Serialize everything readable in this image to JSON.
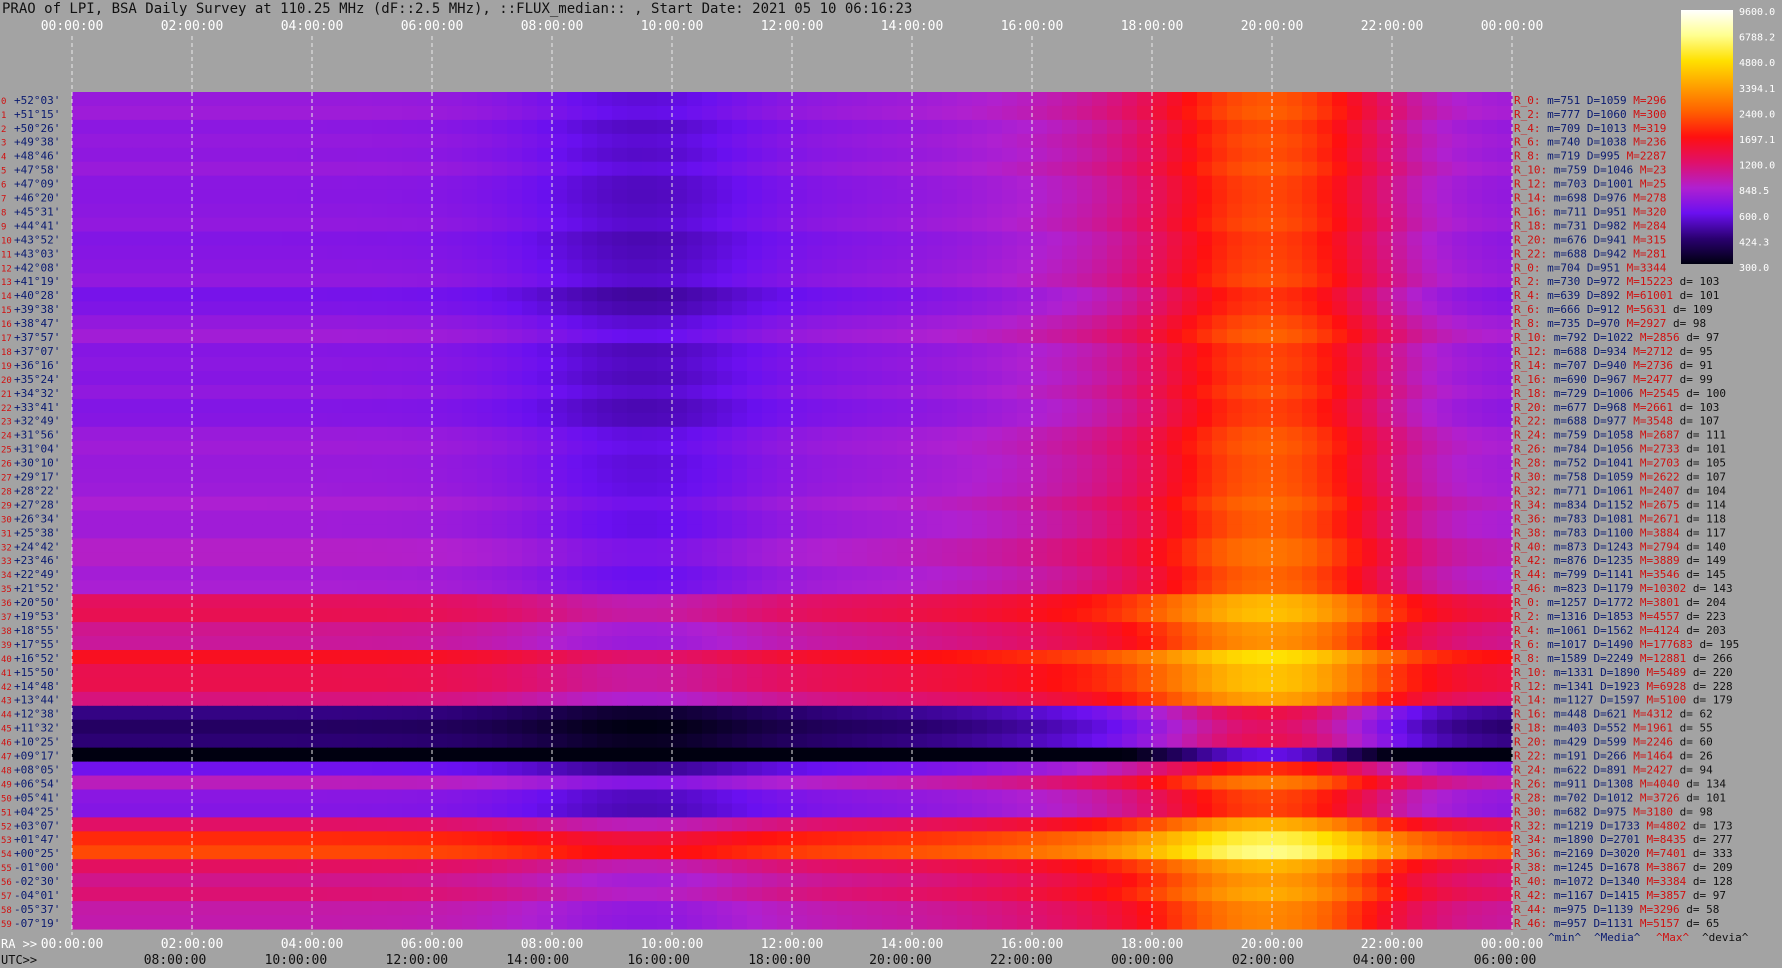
{
  "title": "PRAO of LPI, BSA Daily Survey at 110.25 MHz (dF::2.5 MHz), ::FLUX_median:: , Start Date: 2021 05 10 06:16:23",
  "bottom_labels": {
    "ra": "RA >>",
    "utc": "UTC>>"
  },
  "stats_footer": {
    "min": "^min^",
    "media": "^Media^",
    "max": "^Max^",
    "devia": "^devia^"
  },
  "colorbar": {
    "labels": [
      "9600.0",
      "6788.2",
      "4800.0",
      "3394.1",
      "2400.0",
      "1697.1",
      "1200.0",
      "848.5",
      "600.0",
      "424.3",
      "300.0"
    ],
    "colors": [
      "#ffffff",
      "#ffff90",
      "#ffe000",
      "#ffa000",
      "#ff6000",
      "#ff1010",
      "#e0106a",
      "#b020d0",
      "#6a10f0",
      "#2a0070",
      "#000010"
    ]
  },
  "chart_data": {
    "type": "heatmap",
    "title": "PRAO of LPI, BSA Daily Survey at 110.25 MHz (dF::2.5 MHz), ::FLUX_median:: , Start Date: 2021 05 10 06:16:23",
    "x_top_ticks": [
      "00:00:00",
      "02:00:00",
      "04:00:00",
      "06:00:00",
      "08:00:00",
      "10:00:00",
      "12:00:00",
      "14:00:00",
      "16:00:00",
      "18:00:00",
      "20:00:00",
      "22:00:00",
      "00:00:00"
    ],
    "x_ra_ticks": [
      "00:00:00",
      "02:00:00",
      "04:00:00",
      "06:00:00",
      "08:00:00",
      "10:00:00",
      "12:00:00",
      "14:00:00",
      "16:00:00",
      "18:00:00",
      "20:00:00",
      "22:00:00",
      "00:00:00"
    ],
    "x_utc_ticks": [
      "08:00:00",
      "10:00:00",
      "12:00:00",
      "14:00:00",
      "16:00:00",
      "18:00:00",
      "20:00:00",
      "22:00:00",
      "00:00:00",
      "02:00:00",
      "04:00:00",
      "06:00:00"
    ],
    "rows": [
      {
        "idx": "0",
        "dec": "+52°03'"
      },
      {
        "idx": "1",
        "dec": "+51°15'"
      },
      {
        "idx": "2",
        "dec": "+50°26'"
      },
      {
        "idx": "3",
        "dec": "+49°38'"
      },
      {
        "idx": "4",
        "dec": "+48°46'"
      },
      {
        "idx": "5",
        "dec": "+47°58'"
      },
      {
        "idx": "6",
        "dec": "+47°09'"
      },
      {
        "idx": "7",
        "dec": "+46°20'"
      },
      {
        "idx": "8",
        "dec": "+45°31'"
      },
      {
        "idx": "9",
        "dec": "+44°41'"
      },
      {
        "idx": "10",
        "dec": "+43°52'"
      },
      {
        "idx": "11",
        "dec": "+43°03'"
      },
      {
        "idx": "12",
        "dec": "+42°08'"
      },
      {
        "idx": "13",
        "dec": "+41°19'"
      },
      {
        "idx": "14",
        "dec": "+40°28'"
      },
      {
        "idx": "15",
        "dec": "+39°38'"
      },
      {
        "idx": "16",
        "dec": "+38°47'"
      },
      {
        "idx": "17",
        "dec": "+37°57'"
      },
      {
        "idx": "18",
        "dec": "+37°07'"
      },
      {
        "idx": "19",
        "dec": "+36°16'"
      },
      {
        "idx": "20",
        "dec": "+35°24'"
      },
      {
        "idx": "21",
        "dec": "+34°32'"
      },
      {
        "idx": "22",
        "dec": "+33°41'"
      },
      {
        "idx": "23",
        "dec": "+32°49'"
      },
      {
        "idx": "24",
        "dec": "+31°56'"
      },
      {
        "idx": "25",
        "dec": "+31°04'"
      },
      {
        "idx": "26",
        "dec": "+30°10'"
      },
      {
        "idx": "27",
        "dec": "+29°17'"
      },
      {
        "idx": "28",
        "dec": "+28°22'"
      },
      {
        "idx": "29",
        "dec": "+27°28'"
      },
      {
        "idx": "30",
        "dec": "+26°34'"
      },
      {
        "idx": "31",
        "dec": "+25°38'"
      },
      {
        "idx": "32",
        "dec": "+24°42'"
      },
      {
        "idx": "33",
        "dec": "+23°46'"
      },
      {
        "idx": "34",
        "dec": "+22°49'"
      },
      {
        "idx": "35",
        "dec": "+21°52'"
      },
      {
        "idx": "36",
        "dec": "+20°50'"
      },
      {
        "idx": "37",
        "dec": "+19°53'"
      },
      {
        "idx": "38",
        "dec": "+18°55'"
      },
      {
        "idx": "39",
        "dec": "+17°55'"
      },
      {
        "idx": "40",
        "dec": "+16°52'"
      },
      {
        "idx": "41",
        "dec": "+15°50'"
      },
      {
        "idx": "42",
        "dec": "+14°48'"
      },
      {
        "idx": "43",
        "dec": "+13°44'"
      },
      {
        "idx": "44",
        "dec": "+12°38'"
      },
      {
        "idx": "45",
        "dec": "+11°32'"
      },
      {
        "idx": "46",
        "dec": "+10°25'"
      },
      {
        "idx": "47",
        "dec": "+09°17'"
      },
      {
        "idx": "48",
        "dec": "+08°05'"
      },
      {
        "idx": "49",
        "dec": "+06°54'"
      },
      {
        "idx": "50",
        "dec": "+05°41'"
      },
      {
        "idx": "51",
        "dec": "+04°25'"
      },
      {
        "idx": "52",
        "dec": "+03°07'"
      },
      {
        "idx": "53",
        "dec": "+01°47'"
      },
      {
        "idx": "54",
        "dec": "+00°25'"
      },
      {
        "idx": "55",
        "dec": "-01°00'"
      },
      {
        "idx": "56",
        "dec": "-02°30'"
      },
      {
        "idx": "57",
        "dec": "-04°01'"
      },
      {
        "idx": "58",
        "dec": "-05°37'"
      },
      {
        "idx": "59",
        "dec": "-07°19'"
      }
    ],
    "stats": [
      {
        "r": "R_0:",
        "m": "m=751",
        "d": "D=1059",
        "M": "M=296",
        "dd": ""
      },
      {
        "r": "R_2:",
        "m": "m=777",
        "d": "D=1060",
        "M": "M=300",
        "dd": ""
      },
      {
        "r": "R_4:",
        "m": "m=709",
        "d": "D=1013",
        "M": "M=319",
        "dd": ""
      },
      {
        "r": "R_6:",
        "m": "m=740",
        "d": "D=1038",
        "M": "M=236",
        "dd": ""
      },
      {
        "r": "R_8:",
        "m": "m=719",
        "d": "D=995",
        "M": "M=2287",
        "dd": ""
      },
      {
        "r": "R_10:",
        "m": "m=759",
        "d": "D=1046",
        "M": "M=23",
        "dd": ""
      },
      {
        "r": "R_12:",
        "m": "m=703",
        "d": "D=1001",
        "M": "M=25",
        "dd": ""
      },
      {
        "r": "R_14:",
        "m": "m=698",
        "d": "D=976",
        "M": "M=278",
        "dd": ""
      },
      {
        "r": "R_16:",
        "m": "m=711",
        "d": "D=951",
        "M": "M=320",
        "dd": ""
      },
      {
        "r": "R_18:",
        "m": "m=731",
        "d": "D=982",
        "M": "M=284",
        "dd": ""
      },
      {
        "r": "R_20:",
        "m": "m=676",
        "d": "D=941",
        "M": "M=315",
        "dd": ""
      },
      {
        "r": "R_22:",
        "m": "m=688",
        "d": "D=942",
        "M": "M=281",
        "dd": ""
      },
      {
        "r": "R_0:",
        "m": "m=704",
        "d": "D=951",
        "M": "M=3344",
        "dd": ""
      },
      {
        "r": "R_2:",
        "m": "m=730",
        "d": "D=972",
        "M": "M=15223",
        "dd": "d= 103"
      },
      {
        "r": "R_4:",
        "m": "m=639",
        "d": "D=892",
        "M": "M=61001",
        "dd": "d= 101"
      },
      {
        "r": "R_6:",
        "m": "m=666",
        "d": "D=912",
        "M": "M=5631",
        "dd": "d= 109"
      },
      {
        "r": "R_8:",
        "m": "m=735",
        "d": "D=970",
        "M": "M=2927",
        "dd": "d= 98"
      },
      {
        "r": "R_10:",
        "m": "m=792",
        "d": "D=1022",
        "M": "M=2856",
        "dd": "d= 97"
      },
      {
        "r": "R_12:",
        "m": "m=688",
        "d": "D=934",
        "M": "M=2712",
        "dd": "d= 95"
      },
      {
        "r": "R_14:",
        "m": "m=707",
        "d": "D=940",
        "M": "M=2736",
        "dd": "d= 91"
      },
      {
        "r": "R_16:",
        "m": "m=690",
        "d": "D=967",
        "M": "M=2477",
        "dd": "d= 99"
      },
      {
        "r": "R_18:",
        "m": "m=729",
        "d": "D=1006",
        "M": "M=2545",
        "dd": "d= 100"
      },
      {
        "r": "R_20:",
        "m": "m=677",
        "d": "D=968",
        "M": "M=2661",
        "dd": "d= 103"
      },
      {
        "r": "R_22:",
        "m": "m=688",
        "d": "D=977",
        "M": "M=3548",
        "dd": "d= 107"
      },
      {
        "r": "R_24:",
        "m": "m=759",
        "d": "D=1058",
        "M": "M=2687",
        "dd": "d= 111"
      },
      {
        "r": "R_26:",
        "m": "m=784",
        "d": "D=1056",
        "M": "M=2733",
        "dd": "d= 101"
      },
      {
        "r": "R_28:",
        "m": "m=752",
        "d": "D=1041",
        "M": "M=2703",
        "dd": "d= 105"
      },
      {
        "r": "R_30:",
        "m": "m=758",
        "d": "D=1059",
        "M": "M=2622",
        "dd": "d= 107"
      },
      {
        "r": "R_32:",
        "m": "m=771",
        "d": "D=1061",
        "M": "M=2407",
        "dd": "d= 104"
      },
      {
        "r": "R_34:",
        "m": "m=834",
        "d": "D=1152",
        "M": "M=2675",
        "dd": "d= 114"
      },
      {
        "r": "R_36:",
        "m": "m=783",
        "d": "D=1081",
        "M": "M=2671",
        "dd": "d= 118"
      },
      {
        "r": "R_38:",
        "m": "m=783",
        "d": "D=1100",
        "M": "M=3884",
        "dd": "d= 117"
      },
      {
        "r": "R_40:",
        "m": "m=873",
        "d": "D=1243",
        "M": "M=2794",
        "dd": "d= 140"
      },
      {
        "r": "R_42:",
        "m": "m=876",
        "d": "D=1235",
        "M": "M=3889",
        "dd": "d= 149"
      },
      {
        "r": "R_44:",
        "m": "m=799",
        "d": "D=1141",
        "M": "M=3546",
        "dd": "d= 145"
      },
      {
        "r": "R_46:",
        "m": "m=823",
        "d": "D=1179",
        "M": "M=10302",
        "dd": "d= 143"
      },
      {
        "r": "R_0:",
        "m": "m=1257",
        "d": "D=1772",
        "M": "M=3801",
        "dd": "d= 204"
      },
      {
        "r": "R_2:",
        "m": "m=1316",
        "d": "D=1853",
        "M": "M=4557",
        "dd": "d= 223"
      },
      {
        "r": "R_4:",
        "m": "m=1061",
        "d": "D=1562",
        "M": "M=4124",
        "dd": "d= 203"
      },
      {
        "r": "R_6:",
        "m": "m=1017",
        "d": "D=1490",
        "M": "M=177683",
        "dd": "d= 195"
      },
      {
        "r": "R_8:",
        "m": "m=1589",
        "d": "D=2249",
        "M": "M=12881",
        "dd": "d= 266"
      },
      {
        "r": "R_10:",
        "m": "m=1331",
        "d": "D=1890",
        "M": "M=5489",
        "dd": "d= 220"
      },
      {
        "r": "R_12:",
        "m": "m=1341",
        "d": "D=1923",
        "M": "M=6928",
        "dd": "d= 228"
      },
      {
        "r": "R_14:",
        "m": "m=1127",
        "d": "D=1597",
        "M": "M=5100",
        "dd": "d= 179"
      },
      {
        "r": "R_16:",
        "m": "m=448",
        "d": "D=621",
        "M": "M=4312",
        "dd": "d= 62"
      },
      {
        "r": "R_18:",
        "m": "m=403",
        "d": "D=552",
        "M": "M=1961",
        "dd": "d= 55"
      },
      {
        "r": "R_20:",
        "m": "m=429",
        "d": "D=599",
        "M": "M=2246",
        "dd": "d= 60"
      },
      {
        "r": "R_22:",
        "m": "m=191",
        "d": "D=266",
        "M": "M=1464",
        "dd": "d= 26"
      },
      {
        "r": "R_24:",
        "m": "m=622",
        "d": "D=891",
        "M": "M=2427",
        "dd": "d= 94"
      },
      {
        "r": "R_26:",
        "m": "m=911",
        "d": "D=1308",
        "M": "M=4040",
        "dd": "d= 134"
      },
      {
        "r": "R_28:",
        "m": "m=702",
        "d": "D=1012",
        "M": "M=3726",
        "dd": "d= 101"
      },
      {
        "r": "R_30:",
        "m": "m=682",
        "d": "D=975",
        "M": "M=3180",
        "dd": "d= 98"
      },
      {
        "r": "R_32:",
        "m": "m=1219",
        "d": "D=1733",
        "M": "M=4802",
        "dd": "d= 173"
      },
      {
        "r": "R_34:",
        "m": "m=1890",
        "d": "D=2701",
        "M": "M=8435",
        "dd": "d= 277"
      },
      {
        "r": "R_36:",
        "m": "m=2169",
        "d": "D=3020",
        "M": "M=7401",
        "dd": "d= 333"
      },
      {
        "r": "R_38:",
        "m": "m=1245",
        "d": "D=1678",
        "M": "M=3867",
        "dd": "d= 209"
      },
      {
        "r": "R_40:",
        "m": "m=1072",
        "d": "D=1340",
        "M": "M=3384",
        "dd": "d= 128"
      },
      {
        "r": "R_42:",
        "m": "m=1167",
        "d": "D=1415",
        "M": "M=3857",
        "dd": "d= 97"
      },
      {
        "r": "R_44:",
        "m": "m=975",
        "d": "D=1139",
        "M": "M=3296",
        "dd": "d= 58"
      },
      {
        "r": "R_46:",
        "m": "m=957",
        "d": "D=1131",
        "M": "M=5157",
        "dd": "d= 65"
      }
    ],
    "row_values": [
      751,
      777,
      709,
      740,
      719,
      759,
      703,
      698,
      711,
      731,
      676,
      688,
      704,
      730,
      639,
      666,
      735,
      792,
      688,
      707,
      690,
      729,
      677,
      688,
      759,
      784,
      752,
      758,
      771,
      834,
      783,
      783,
      873,
      876,
      799,
      823,
      1257,
      1316,
      1061,
      1017,
      1589,
      1331,
      1341,
      1127,
      448,
      403,
      429,
      191,
      622,
      911,
      702,
      682,
      1219,
      1890,
      2169,
      1245,
      1072,
      1167,
      975,
      957
    ]
  }
}
